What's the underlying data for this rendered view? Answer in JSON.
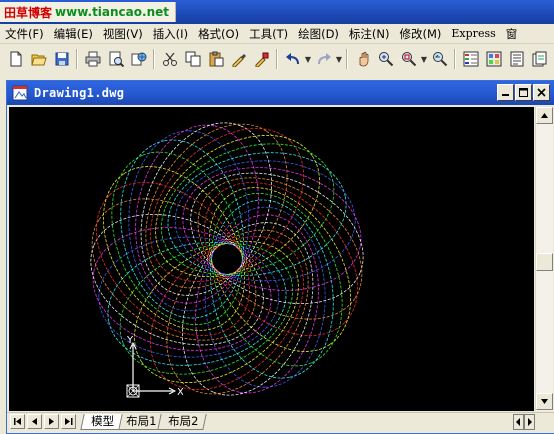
{
  "watermark": {
    "name": "田草博客",
    "url": "www.tiancao.net"
  },
  "menu": [
    {
      "label": "文件(F)"
    },
    {
      "label": "编辑(E)"
    },
    {
      "label": "视图(V)"
    },
    {
      "label": "插入(I)"
    },
    {
      "label": "格式(O)"
    },
    {
      "label": "工具(T)"
    },
    {
      "label": "绘图(D)"
    },
    {
      "label": "标注(N)"
    },
    {
      "label": "修改(M)"
    },
    {
      "label": "Express"
    },
    {
      "label": "窗"
    }
  ],
  "toolbar": {
    "icons": [
      "new-icon",
      "open-icon",
      "save-icon",
      "print-icon",
      "print-preview-icon",
      "publish-icon",
      "cut-icon",
      "copy-icon",
      "paste-icon",
      "match-properties-icon",
      "block-editor-icon",
      "undo-icon",
      "redo-icon",
      "pan-icon",
      "zoom-realtime-icon",
      "zoom-window-icon",
      "zoom-previous-icon",
      "properties-icon",
      "design-center-icon",
      "tool-palettes-icon",
      "sheet-set-icon"
    ]
  },
  "drawing_window": {
    "title": "Drawing1.dwg",
    "ucs": {
      "x_label": "X",
      "y_label": "Y"
    },
    "canvas_background": "#000000"
  },
  "layout_tabs": [
    {
      "label": "模型",
      "active": true
    },
    {
      "label": "布局1",
      "active": false
    },
    {
      "label": "布局2",
      "active": false
    }
  ],
  "colors": {
    "titlebar": "#2558cf",
    "watermark_name": "#d10000",
    "watermark_url": "#0a8f1e",
    "spiro_palette": [
      "#ff3333",
      "#ffff33",
      "#33ff33",
      "#33ffff",
      "#4466ff",
      "#ff33ff",
      "#ffffff",
      "#ff9933"
    ]
  }
}
